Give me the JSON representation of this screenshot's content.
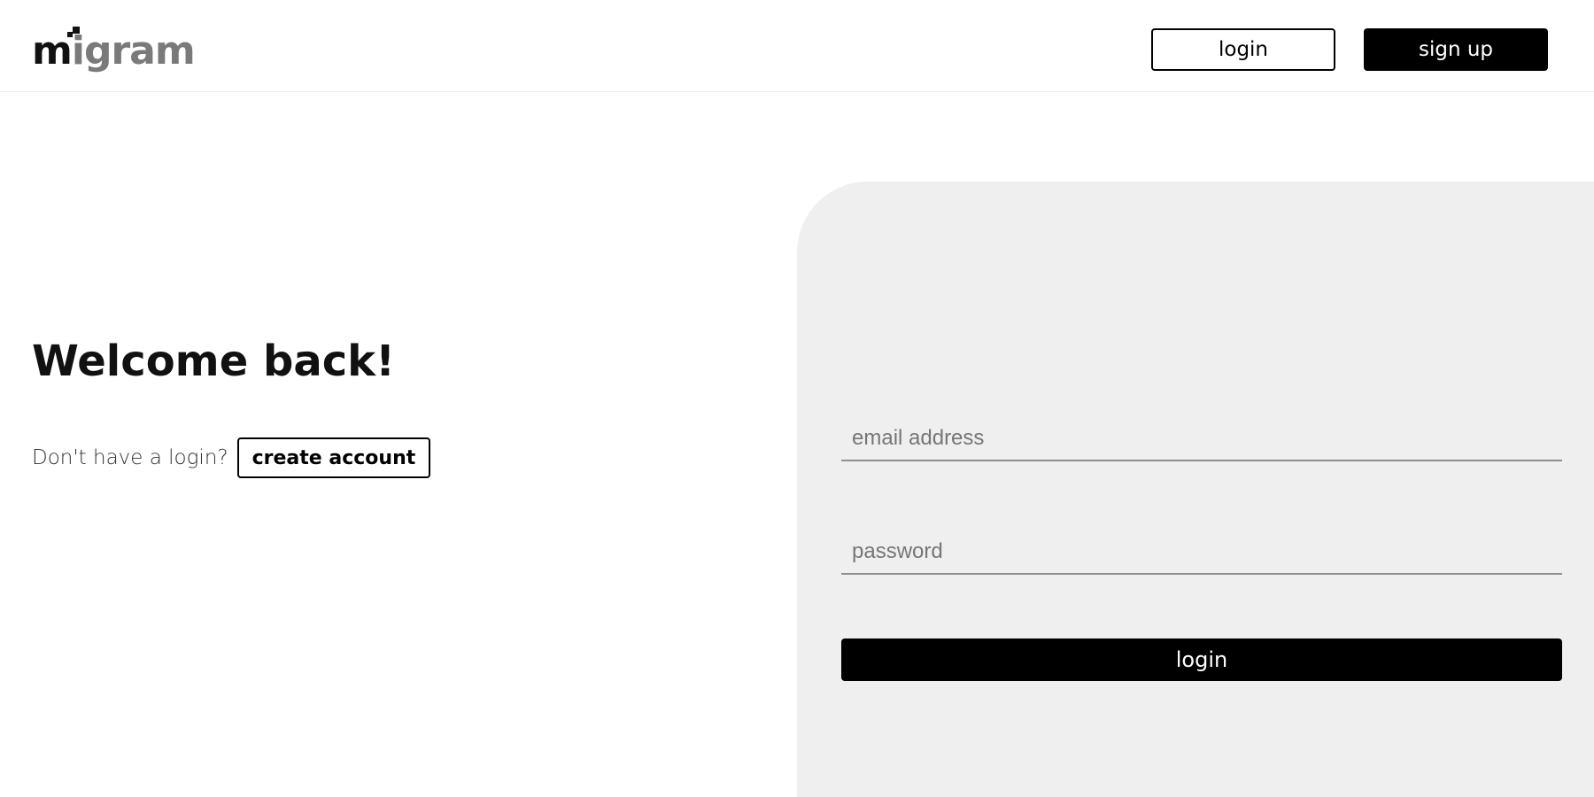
{
  "header": {
    "logo": {
      "text_dark": "m",
      "text_light": "igram"
    },
    "login_label": "login",
    "signup_label": "sign up"
  },
  "welcome": {
    "title": "Welcome back!",
    "prompt": "Don't have a login?",
    "create_account_label": "create account"
  },
  "form": {
    "email_placeholder": "email address",
    "password_placeholder": "password",
    "submit_label": "login"
  },
  "colors": {
    "primary": "#000000",
    "panel_bg": "#efefef",
    "logo_light": "#7a7a7a"
  }
}
